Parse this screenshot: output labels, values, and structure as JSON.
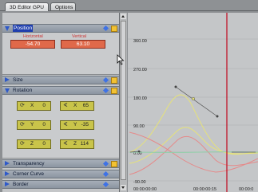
{
  "tabs": [
    {
      "label": "3D Editor GPU",
      "active": true
    },
    {
      "label": "Options",
      "active": false
    }
  ],
  "sections": {
    "position": {
      "label": "Position",
      "horizontal_label": "Horizontal",
      "vertical_label": "Vertical",
      "horizontal_value": "-54.70",
      "vertical_value": "63.10"
    },
    "size": {
      "label": "Size"
    },
    "rotation": {
      "label": "Rotation",
      "fields": [
        {
          "axis": "X",
          "value": "0",
          "icon": "rotate-icon"
        },
        {
          "axis": "X",
          "value": "65",
          "icon": "angle-icon"
        },
        {
          "axis": "Y",
          "value": "0",
          "icon": "rotate-icon"
        },
        {
          "axis": "Y",
          "value": "-35",
          "icon": "angle-icon"
        },
        {
          "axis": "Z",
          "value": "0",
          "icon": "rotate-icon"
        },
        {
          "axis": "Z",
          "value": "114",
          "icon": "angle-icon"
        }
      ]
    },
    "transparency": {
      "label": "Transparency"
    },
    "corner_curve": {
      "label": "Corner Curve"
    },
    "border": {
      "label": "Border"
    }
  },
  "graph": {
    "y_ticks": [
      "360.00",
      "270.00",
      "180.00",
      "90.00",
      "0.00",
      "-90.00"
    ],
    "x_ticks": [
      "00:00:00:00",
      "00:00:00:15",
      "00:00:0"
    ],
    "playhead_color": "#c0142a",
    "curve_colors": [
      "#e6e27a",
      "#e58a8a",
      "#8fd0a8"
    ]
  }
}
